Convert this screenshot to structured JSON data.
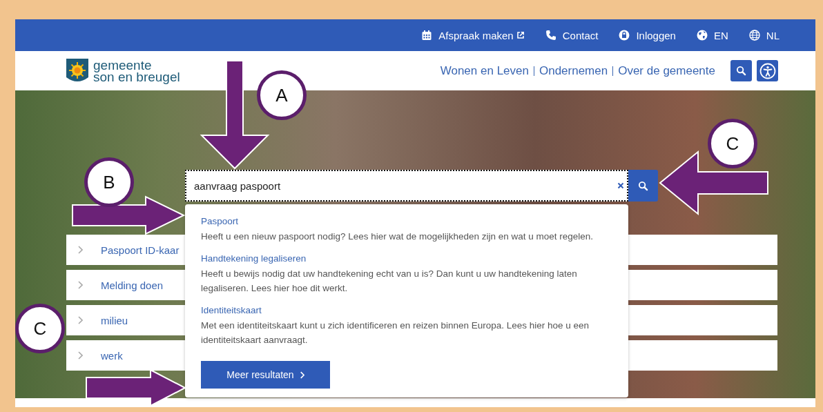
{
  "top_bar": {
    "links": [
      {
        "kind": "calendar",
        "label": "Afspraak maken",
        "external": true
      },
      {
        "kind": "phone",
        "label": "Contact",
        "external": false
      },
      {
        "kind": "lock",
        "label": "Inloggen",
        "external": false
      },
      {
        "kind": "globe",
        "label": "EN",
        "external": false
      },
      {
        "kind": "language",
        "label": "NL",
        "external": false
      }
    ]
  },
  "header": {
    "logo_lines": [
      "gemeente",
      "son en breugel"
    ],
    "nav": [
      {
        "label": "Wonen en Leven"
      },
      {
        "label": "Ondernemen"
      },
      {
        "label": "Over de gemeente"
      }
    ]
  },
  "search": {
    "value": "aanvraag paspoort",
    "suggestions": [
      {
        "title": "Paspoort",
        "description": "Heeft u een nieuw paspoort nodig? Lees hier wat de mogelijkheden zijn en wat u moet regelen."
      },
      {
        "title": "Handtekening legaliseren",
        "description": "Heeft u bewijs nodig dat uw handtekening echt van u is? Dan kunt u uw handtekening laten legaliseren. Lees hier hoe dit werkt."
      },
      {
        "title": "Identiteitskaart",
        "description": "Met een identiteitskaart kunt u zich identificeren en reizen binnen Europa. Lees hier hoe u een identiteitskaart aanvraagt."
      }
    ],
    "more_button": "Meer resultaten"
  },
  "quick_links": [
    {
      "label": "Paspoort ID-kaar"
    },
    {
      "label": "Melding doen"
    },
    {
      "label": "milieu"
    },
    {
      "label": "werk"
    }
  ],
  "annotations": [
    {
      "label": "A"
    },
    {
      "label": "B"
    },
    {
      "label": "C"
    },
    {
      "label": "C"
    }
  ]
}
